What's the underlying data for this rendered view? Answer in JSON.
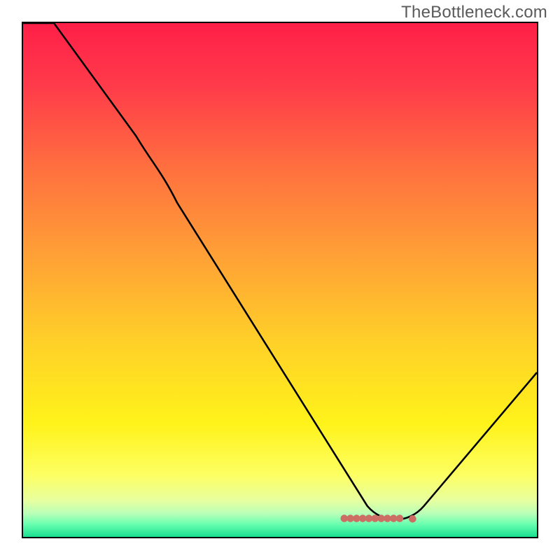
{
  "watermark": "TheBottleneck.com",
  "chart_data": {
    "type": "line",
    "title": "",
    "xlabel": "",
    "ylabel": "",
    "xlim": [
      0,
      100
    ],
    "ylim": [
      0,
      100
    ],
    "grid": false,
    "legend": false,
    "background": {
      "type": "vertical-gradient",
      "stops": [
        {
          "offset": 0.0,
          "color": "#ff1f48"
        },
        {
          "offset": 0.12,
          "color": "#ff3a4a"
        },
        {
          "offset": 0.28,
          "color": "#ff6f3f"
        },
        {
          "offset": 0.45,
          "color": "#ffa036"
        },
        {
          "offset": 0.62,
          "color": "#ffd028"
        },
        {
          "offset": 0.78,
          "color": "#fff31a"
        },
        {
          "offset": 0.88,
          "color": "#fdff63"
        },
        {
          "offset": 0.93,
          "color": "#e6ffa0"
        },
        {
          "offset": 0.955,
          "color": "#b8ffb8"
        },
        {
          "offset": 0.975,
          "color": "#6affb0"
        },
        {
          "offset": 1.0,
          "color": "#18e090"
        }
      ]
    },
    "series": [
      {
        "name": "bottleneck-curve",
        "color": "#000000",
        "x": [
          0,
          6,
          22,
          30,
          67,
          72.5,
          78,
          100
        ],
        "y": [
          100,
          100,
          78,
          65,
          6,
          2.5,
          6,
          32
        ]
      }
    ],
    "markers": {
      "name": "optimal-range",
      "color": "#cc6e63",
      "points": [
        {
          "x": 62.5,
          "y": 3.6
        },
        {
          "x": 63.7,
          "y": 3.6
        },
        {
          "x": 64.9,
          "y": 3.6
        },
        {
          "x": 66.1,
          "y": 3.6
        },
        {
          "x": 67.3,
          "y": 3.6
        },
        {
          "x": 68.5,
          "y": 3.6
        },
        {
          "x": 69.7,
          "y": 3.6
        },
        {
          "x": 70.9,
          "y": 3.6
        },
        {
          "x": 72.1,
          "y": 3.6
        },
        {
          "x": 73.3,
          "y": 3.6
        },
        {
          "x": 75.8,
          "y": 3.5
        }
      ]
    }
  }
}
